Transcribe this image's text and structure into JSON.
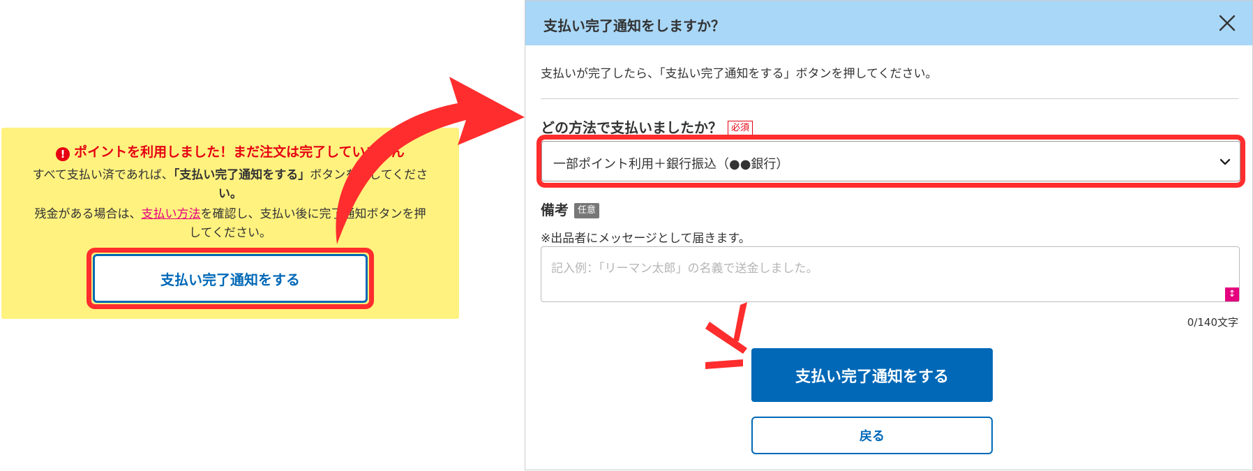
{
  "notice": {
    "icon": "alert-circle-icon",
    "title": "ポイントを利用しました！まだ注文は完了していません",
    "line1_pre": "すべて支払い済であれば、",
    "line1_bold": "「支払い完了通知をする」",
    "line1_post": "ボタンを押してくださ",
    "line2_bold": "い。",
    "line3_pre": "残金がある場合は、",
    "line3_link": "支払い方法",
    "line3_post": "を確認し、支払い後に完了通知ボタンを押",
    "line4": "してください。",
    "button_label": "支払い完了通知をする"
  },
  "modal": {
    "title": "支払い完了通知をしますか？",
    "close_icon": "close-icon",
    "description": "支払いが完了したら、「支払い完了通知をする」ボタンを押してください。",
    "question": "どの方法で支払いましたか？",
    "required_badge": "必須",
    "select_value": "一部ポイント利用＋銀行振込（●●銀行）",
    "memo_label": "備考",
    "optional_badge": "任意",
    "memo_note": "※出品者にメッセージとして届きます。",
    "memo_placeholder": "記入例：「リーマン太郎」の名義で送金しました。",
    "counter": "0/140文字",
    "submit_label": "支払い完了通知をする",
    "back_label": "戻る"
  },
  "colors": {
    "highlight_red": "#ff2d2d",
    "brand_blue": "#0068b7",
    "notice_yellow": "#fff27f",
    "header_blue": "#a9d7f7",
    "link_pink": "#e4007f",
    "alert_red": "#e60012"
  }
}
